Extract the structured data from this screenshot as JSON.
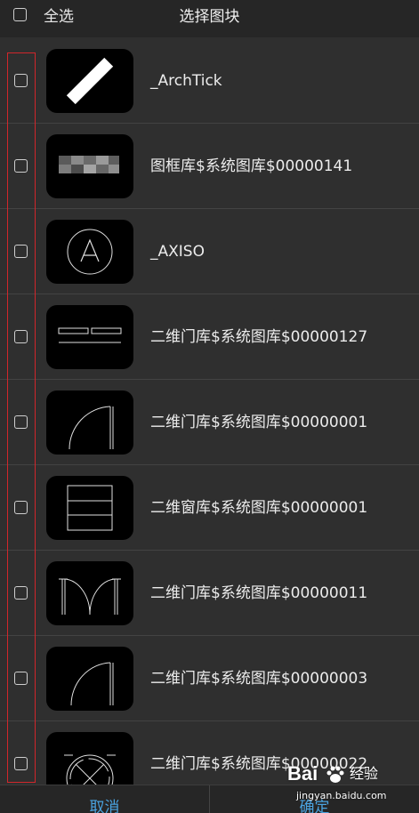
{
  "header": {
    "select_all_label": "全选",
    "title": "选择图块"
  },
  "blocks": [
    {
      "name": "_ArchTick",
      "preview": "arch-tick-preview"
    },
    {
      "name": "图框库$系统图库$00000141",
      "preview": "frame-preview"
    },
    {
      "name": "_AXISO",
      "preview": "axis-circle-preview"
    },
    {
      "name": "二维门库$系统图库$00000127",
      "preview": "sliding-door-preview"
    },
    {
      "name": "二维门库$系统图库$00000001",
      "preview": "single-door-preview"
    },
    {
      "name": "二维窗库$系统图库$00000001",
      "preview": "window-preview"
    },
    {
      "name": "二维门库$系统图库$00000011",
      "preview": "double-door-preview"
    },
    {
      "name": "二维门库$系统图库$00000003",
      "preview": "single-door-preview"
    },
    {
      "name": "二维门库$系统图库$00000022",
      "preview": "revolving-door-preview"
    }
  ],
  "footer": {
    "cancel_label": "取消",
    "confirm_label": "确定"
  },
  "watermark": {
    "brand": "Bai",
    "brand_suffix": "经验",
    "url": "jingyan.baidu.com"
  },
  "colors": {
    "background": "#2f2f2f",
    "header": "#262626",
    "accent": "#4aa3e0",
    "highlight": "#d1262b"
  }
}
